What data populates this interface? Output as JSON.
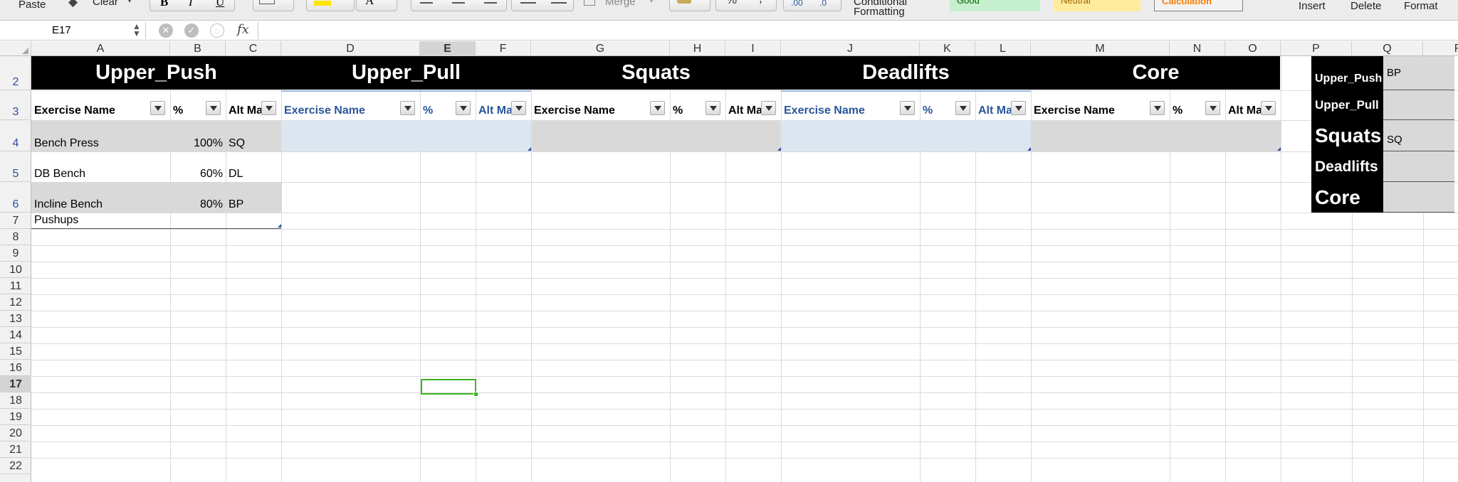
{
  "ribbon": {
    "paste_label": "Paste",
    "clear_label": "Clear",
    "merge_label": "Merge",
    "percent_symbol": "%",
    "comma_symbol": ",",
    "decimal_increase_label": ".00",
    "decimal_decrease_label": ".0",
    "conditional_formatting_line1": "Conditional",
    "conditional_formatting_line2": "Formatting",
    "styles": [
      {
        "label": "Good",
        "bg": "#c6efce",
        "color": "#006100"
      },
      {
        "label": "Neutral",
        "bg": "#ffeb9c",
        "color": "#9c6500"
      },
      {
        "label": "Calculation",
        "bg": "#f2f2f2",
        "color": "#fa7d00"
      }
    ],
    "insert_label": "Insert",
    "delete_label": "Delete",
    "format_label": "Format"
  },
  "formula_bar": {
    "name_box": "E17",
    "fx_label": "fx",
    "formula": ""
  },
  "columns": [
    "A",
    "B",
    "C",
    "D",
    "E",
    "F",
    "G",
    "H",
    "I",
    "J",
    "K",
    "L",
    "M",
    "N",
    "O",
    "P",
    "Q",
    "R"
  ],
  "selected_column": "E",
  "rows": [
    "2",
    "3",
    "4",
    "5",
    "6",
    "7",
    "8",
    "9",
    "10",
    "11",
    "12",
    "13",
    "14",
    "15",
    "16",
    "17",
    "18",
    "19",
    "20",
    "21",
    "22"
  ],
  "selected_row": "17",
  "categories": [
    "Upper_Push",
    "Upper_Pull",
    "Squats",
    "Deadlifts",
    "Core"
  ],
  "table_headers": {
    "name": "Exercise Name",
    "percent": "%",
    "alt": "Alt Ma"
  },
  "upper_push_rows": [
    {
      "name": "Bench Press",
      "percent": "100%",
      "alt": "SQ"
    },
    {
      "name": "DB Bench",
      "percent": "60%",
      "alt": "DL"
    },
    {
      "name": "Incline Bench",
      "percent": "80%",
      "alt": "BP"
    },
    {
      "name": "Pushups",
      "percent": "",
      "alt": ""
    }
  ],
  "side_table": [
    {
      "label": "Upper_Push",
      "value": "BP"
    },
    {
      "label": "Upper_Pull",
      "value": ""
    },
    {
      "label": "Squats",
      "value": "SQ"
    },
    {
      "label": "Deadlifts",
      "value": ""
    },
    {
      "label": "Core",
      "value": ""
    }
  ],
  "colors": {
    "category_bar": "#000000",
    "banded_row": "#d9d9d9",
    "blue_band": "#dce6f1",
    "blue_header_text": "#2a5699",
    "selection": "#3cb521"
  }
}
